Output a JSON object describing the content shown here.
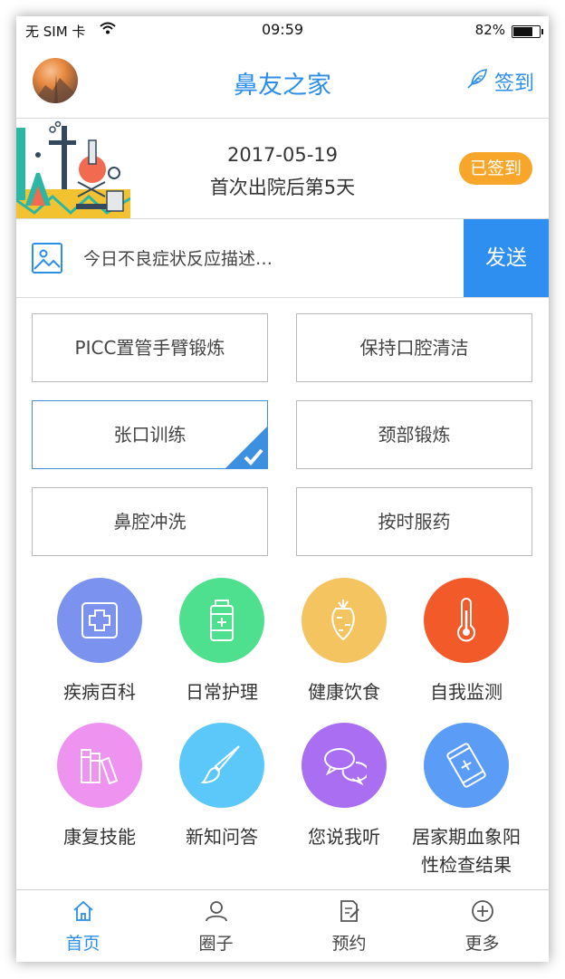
{
  "status_bar": {
    "carrier": "无 SIM 卡",
    "time": "09:59",
    "battery": "82%",
    "battery_level": 0.82
  },
  "header": {
    "title": "鼻友之家",
    "checkin_label": "签到"
  },
  "banner": {
    "date": "2017-05-19",
    "status": "首次出院后第5天",
    "badge": "已签到"
  },
  "symptom": {
    "placeholder": "今日不良症状反应描述…",
    "send_label": "发送"
  },
  "tasks": [
    {
      "label": "PICC置管手臂锻炼",
      "selected": false
    },
    {
      "label": "保持口腔清洁",
      "selected": false
    },
    {
      "label": "张口训练",
      "selected": true
    },
    {
      "label": "颈部锻炼",
      "selected": false
    },
    {
      "label": "鼻腔冲洗",
      "selected": false
    },
    {
      "label": "按时服药",
      "selected": false
    }
  ],
  "features": [
    {
      "label": "疾病百科",
      "icon": "medical-cross-icon",
      "color": "#7b93ee"
    },
    {
      "label": "日常护理",
      "icon": "medicine-bottle-icon",
      "color": "#4fe08f"
    },
    {
      "label": "健康饮食",
      "icon": "carrot-icon",
      "color": "#f4c461"
    },
    {
      "label": "自我监测",
      "icon": "thermometer-icon",
      "color": "#f25a2a"
    },
    {
      "label": "康复技能",
      "icon": "books-icon",
      "color": "#ee94f0"
    },
    {
      "label": "新知问答",
      "icon": "brush-icon",
      "color": "#5cc7f9"
    },
    {
      "label": "您说我听",
      "icon": "chat-bubbles-icon",
      "color": "#a96ef1"
    },
    {
      "label": "居家期血象阳性检查结果",
      "icon": "phone-report-icon",
      "color": "#5b9cf7"
    }
  ],
  "tabs": [
    {
      "label": "首页",
      "icon": "home-icon",
      "active": true
    },
    {
      "label": "圈子",
      "icon": "people-icon",
      "active": false
    },
    {
      "label": "预约",
      "icon": "document-edit-icon",
      "active": false
    },
    {
      "label": "更多",
      "icon": "plus-circle-icon",
      "active": false
    }
  ],
  "colors": {
    "accent": "#2d8ee8",
    "send": "#2f8ff0",
    "badge": "#f8a62a"
  }
}
